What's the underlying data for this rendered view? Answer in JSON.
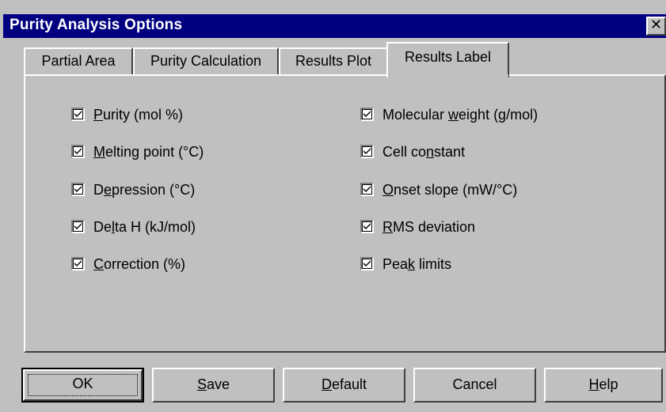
{
  "window": {
    "title": "Purity Analysis Options",
    "close_glyph": "✕",
    "close_icon": "close-icon"
  },
  "tabs": [
    {
      "label": "Partial Area",
      "active": false
    },
    {
      "label": "Purity Calculation",
      "active": false
    },
    {
      "label": "Results Plot",
      "active": false
    },
    {
      "label": "Results Label",
      "active": true
    }
  ],
  "options_left": [
    {
      "pre": "",
      "u": "P",
      "post": "urity (mol %)",
      "checked": true
    },
    {
      "pre": "",
      "u": "M",
      "post": "elting point (°C)",
      "checked": true
    },
    {
      "pre": "D",
      "u": "e",
      "post": "pression (°C)",
      "checked": true
    },
    {
      "pre": "De",
      "u": "l",
      "post": "ta H (kJ/mol)",
      "checked": true
    },
    {
      "pre": "",
      "u": "C",
      "post": "orrection (%)",
      "checked": true
    }
  ],
  "options_right": [
    {
      "pre": "Molecular ",
      "u": "w",
      "post": "eight (g/mol)",
      "checked": true
    },
    {
      "pre": "Cell co",
      "u": "n",
      "post": "stant",
      "checked": true
    },
    {
      "pre": "",
      "u": "O",
      "post": "nset slope (mW/°C)",
      "checked": true
    },
    {
      "pre": "",
      "u": "R",
      "post": "MS deviation",
      "checked": true
    },
    {
      "pre": "Pea",
      "u": "k",
      "post": " limits",
      "checked": true
    }
  ],
  "buttons": {
    "ok": {
      "pre": "",
      "u": "",
      "post": "OK"
    },
    "save": {
      "pre": "",
      "u": "S",
      "post": "ave"
    },
    "default": {
      "pre": "",
      "u": "D",
      "post": "efault"
    },
    "cancel": {
      "pre": "",
      "u": "",
      "post": "Cancel"
    },
    "help": {
      "pre": "",
      "u": "H",
      "post": "elp"
    }
  },
  "colors": {
    "face": "#c0c0c0",
    "titlebar": "#000080",
    "title_text": "#ffffff"
  }
}
